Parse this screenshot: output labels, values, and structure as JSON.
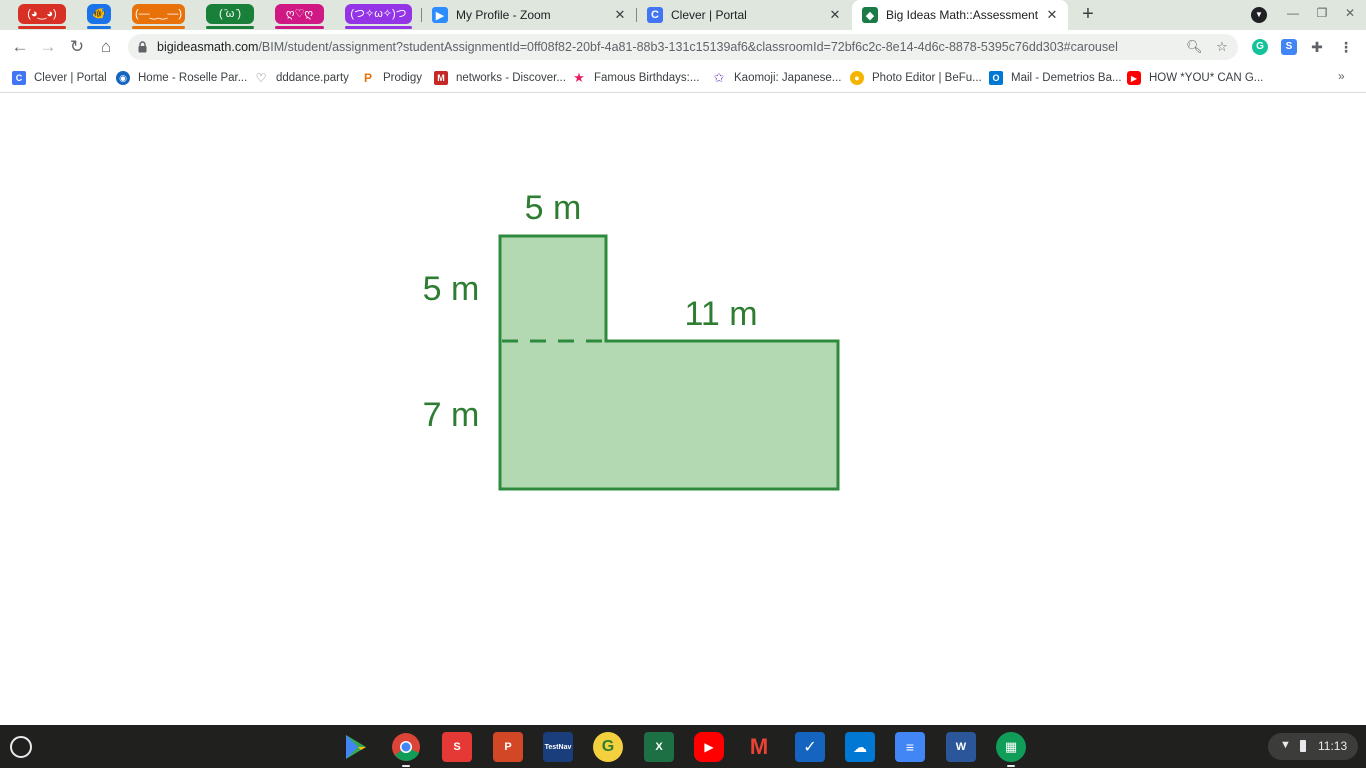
{
  "browser": {
    "tab_groups": [
      {
        "label": "(◕‿◕)",
        "color": "#d93025"
      },
      {
        "label": "🐠",
        "color": "#1a73e8"
      },
      {
        "label": "(—‿‿—)",
        "color": "#e8710a"
      },
      {
        "label": "( ̄ω ̄)",
        "color": "#188038"
      },
      {
        "label": "ღ♡ღ",
        "color": "#d01884"
      },
      {
        "label": "(つ✧ω✧)つ",
        "color": "#9334e6"
      }
    ],
    "tabs": [
      {
        "title": "My Profile - Zoom",
        "icon": "zoom-icon",
        "icon_color": "#2d8cff"
      },
      {
        "title": "Clever | Portal",
        "icon": "clever-icon",
        "icon_color": "#4274f6"
      },
      {
        "title": "Big Ideas Math::Assessment",
        "icon": "big-ideas-math-icon",
        "icon_color": "#1b7a45",
        "active": true
      }
    ],
    "url_host": "bigideasmath.com",
    "url_path": "/BIM/student/assignment?studentAssignmentId=0ff08f82-20bf-4a81-88b3-131c15139af6&classroomId=72bf6c2c-8e14-4d6c-8878-5395c76dd303#carousel",
    "bookmarks": [
      {
        "label": "Clever | Portal",
        "icon": "clever-icon",
        "color": "#4274f6"
      },
      {
        "label": "Home - Roselle Par...",
        "icon": "globe-icon",
        "color": "#1565c0"
      },
      {
        "label": "dddance.party",
        "icon": "heart-icon",
        "color": "#555555"
      },
      {
        "label": "Prodigy",
        "icon": "prodigy-icon",
        "color": "#e8710a"
      },
      {
        "label": "networks - Discover...",
        "icon": "mcgraw-hill-icon",
        "color": "#c62828"
      },
      {
        "label": "Famous Birthdays:...",
        "icon": "star-icon",
        "color": "#e91e63"
      },
      {
        "label": "Kaomoji: Japanese...",
        "icon": "star-outline-icon",
        "color": "#7e57c2"
      },
      {
        "label": "Photo Editor | BeFu...",
        "icon": "befunky-icon",
        "color": "#f4b400"
      },
      {
        "label": "Mail - Demetrios Ba...",
        "icon": "outlook-icon",
        "color": "#0078d4"
      },
      {
        "label": "HOW *YOU* CAN G...",
        "icon": "youtube-icon",
        "color": "#ff0000"
      }
    ]
  },
  "figure": {
    "top_width": "5 m",
    "top_height": "5 m",
    "right_width": "11 m",
    "bottom_height": "7 m",
    "fill_color": "#b3d9b3",
    "stroke_color": "#2e8b3e",
    "label_color": "#2e7d32"
  },
  "shelf": {
    "apps": [
      {
        "name": "play-store-icon",
        "color": "#ffffff"
      },
      {
        "name": "chrome-icon",
        "color": "#4285f4",
        "active": true
      },
      {
        "name": "sketchup-icon",
        "color": "#e53935"
      },
      {
        "name": "powerpoint-icon",
        "color": "#d24726"
      },
      {
        "name": "pearson-testnav-icon",
        "color": "#1a3d7c"
      },
      {
        "name": "grammarly-icon",
        "color": "#f4d03f"
      },
      {
        "name": "excel-icon",
        "color": "#1d7044"
      },
      {
        "name": "youtube-icon",
        "color": "#ff0000"
      },
      {
        "name": "gmail-icon",
        "color": "#ea4335"
      },
      {
        "name": "checkmark-app-icon",
        "color": "#1565c0"
      },
      {
        "name": "onedrive-icon",
        "color": "#0078d4"
      },
      {
        "name": "docs-icon",
        "color": "#4285f4"
      },
      {
        "name": "word-icon",
        "color": "#2b579a"
      },
      {
        "name": "classroom-app-icon",
        "color": "#0f9d58",
        "active": true
      }
    ],
    "time": "11:13"
  }
}
